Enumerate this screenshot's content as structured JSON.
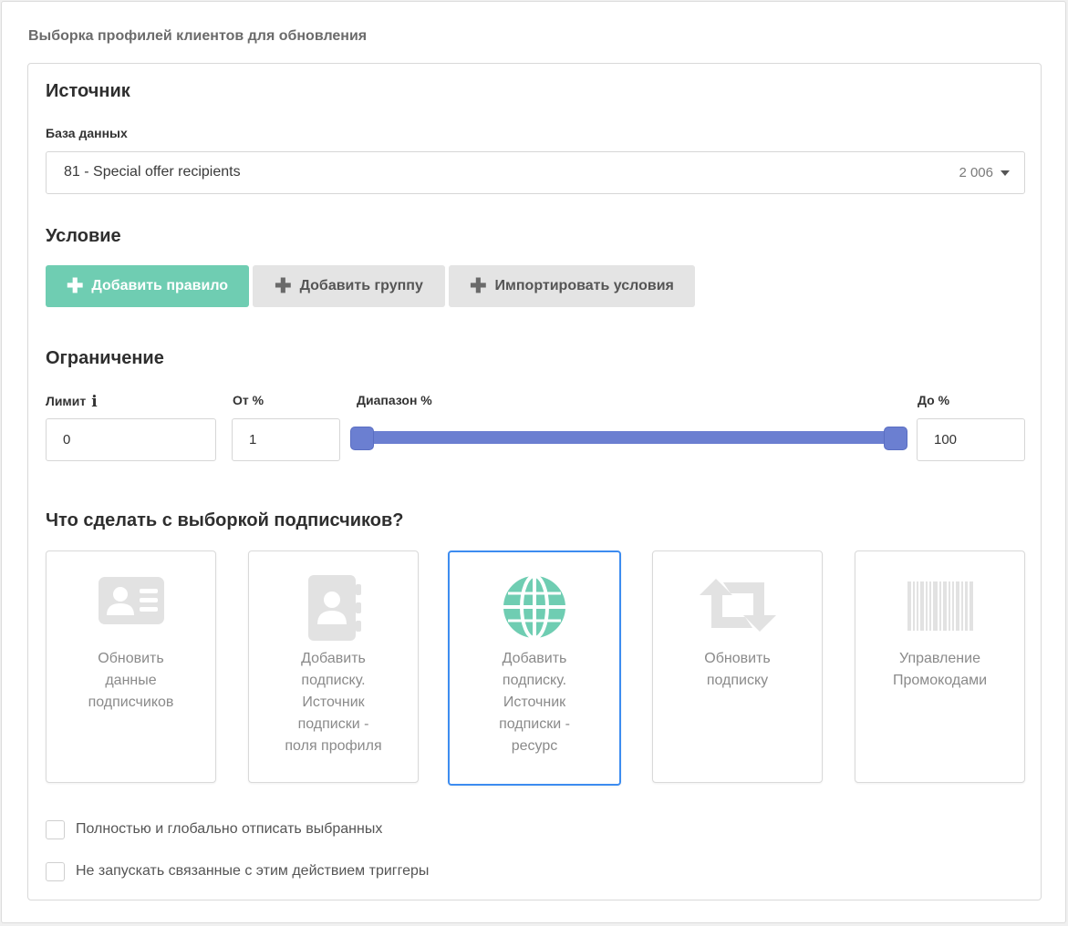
{
  "page": {
    "title": "Выборка профилей клиентов для обновления"
  },
  "source": {
    "title": "Источник",
    "db_label": "База данных",
    "db_value": "81 - Special offer recipients",
    "db_count": "2 006"
  },
  "condition": {
    "title": "Условие",
    "buttons": {
      "add_rule": "Добавить правило",
      "add_group": "Добавить группу",
      "import": "Импортировать условия"
    }
  },
  "limit": {
    "title": "Ограничение",
    "limit_label": "Лимит",
    "limit_value": "0",
    "from_label": "От %",
    "from_value": "1",
    "range_label": "Диапазон %",
    "to_label": "До %",
    "to_value": "100",
    "range_from_percent": 1,
    "range_to_percent": 100
  },
  "actions": {
    "title": "Что сделать с выборкой подписчиков?",
    "cards": [
      {
        "label": "Обновить\nданные\nподписчиков",
        "icon": "contact-card-icon",
        "selected": false
      },
      {
        "label": "Добавить\nподписку.\nИсточник\nподписки -\nполя профиля",
        "icon": "address-book-icon",
        "selected": false
      },
      {
        "label": "Добавить\nподписку.\nИсточник\nподписки -\nресурс",
        "icon": "globe-icon",
        "selected": true
      },
      {
        "label": "Обновить\nподписку",
        "icon": "retweet-arrows-icon",
        "selected": false
      },
      {
        "label": "Управление\nПромокодами",
        "icon": "barcode-icon",
        "selected": false
      }
    ]
  },
  "options": {
    "unsubscribe": "Полностью и глобально отписать выбранных",
    "no_triggers": "Не запускать связанные с этим действием триггеры"
  },
  "colors": {
    "primary": "#6fcdb2",
    "slider": "#6b7fd1",
    "selected_border": "#3d8cf0",
    "icon_gray": "#e2e2e2"
  }
}
